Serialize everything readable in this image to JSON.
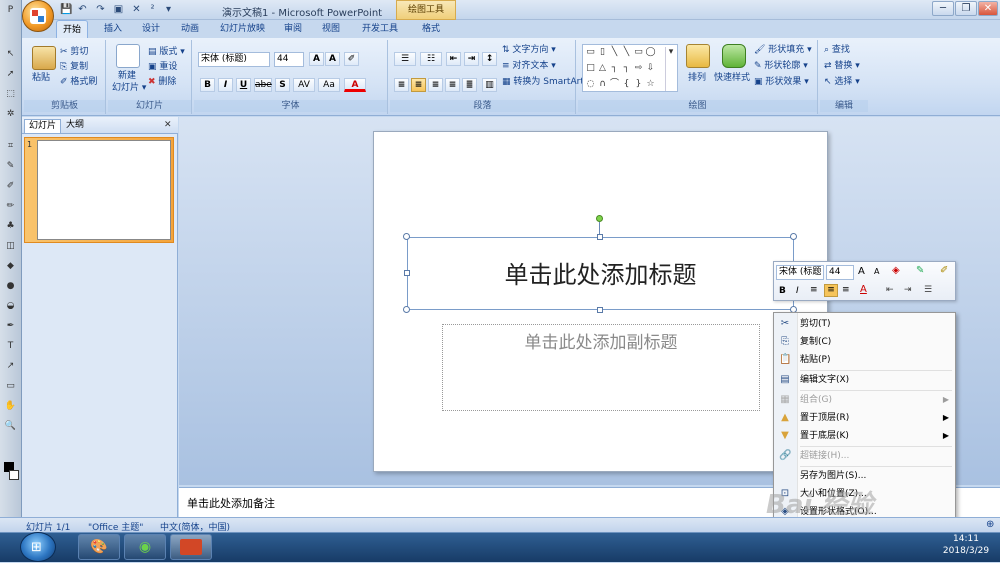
{
  "window": {
    "title": "演示文稿1 - Microsoft PowerPoint",
    "context_tab": "绘图工具",
    "controls": {
      "minimize": "─",
      "restore": "❐",
      "close": "✕"
    }
  },
  "quick_access": [
    "💾",
    "↶",
    "↷",
    "▣",
    "✕",
    "²",
    "▾"
  ],
  "tabs": [
    "开始",
    "插入",
    "设计",
    "动画",
    "幻灯片放映",
    "审阅",
    "视图",
    "开发工具",
    "格式"
  ],
  "active_tab": "开始",
  "ribbon": {
    "clipboard": {
      "label": "剪贴板",
      "paste": "粘贴",
      "cut": "剪切",
      "copy": "复制",
      "format_painter": "格式刷"
    },
    "slides": {
      "label": "幻灯片",
      "new_slide": "新建",
      "new_slide2": "幻灯片 ▾",
      "layout": "版式 ▾",
      "reset": "重设",
      "delete": "删除"
    },
    "font": {
      "label": "字体",
      "font_name": "宋体 (标题)",
      "font_size": "44",
      "bold": "B",
      "italic": "I",
      "underline": "U",
      "strike": "abe",
      "shadow": "S",
      "spacing": "AV",
      "case": "Aa",
      "color": "A"
    },
    "paragraph": {
      "label": "段落",
      "text_direction": "文字方向 ▾",
      "align_text": "对齐文本 ▾",
      "smartart": "转换为 SmartArt ▾"
    },
    "drawing": {
      "label": "绘图",
      "arrange": "排列",
      "quick_styles": "快速样式",
      "shape_fill": "形状填充 ▾",
      "shape_outline": "形状轮廓 ▾",
      "shape_effects": "形状效果 ▾"
    },
    "editing": {
      "label": "编辑",
      "find": "查找",
      "replace": "替换 ▾",
      "select": "选择 ▾"
    }
  },
  "panel": {
    "tab_slides": "幻灯片",
    "tab_outline": "大纲",
    "slide_number": "1"
  },
  "slide": {
    "title_placeholder": "单击此处添加标题",
    "subtitle_placeholder": "单击此处添加副标题"
  },
  "notes_placeholder": "单击此处添加备注",
  "mini_toolbar": {
    "font": "宋体 (标题",
    "size": "44",
    "bold": "B",
    "italic": "I",
    "color": "A"
  },
  "context_menu": [
    {
      "label": "剪切(T)",
      "icon": "✂",
      "disabled": false
    },
    {
      "label": "复制(C)",
      "icon": "⎘",
      "disabled": false
    },
    {
      "label": "粘贴(P)",
      "icon": "📋",
      "disabled": false
    },
    {
      "label": "编辑文字(X)",
      "icon": "▤",
      "disabled": false
    },
    {
      "label": "组合(G)",
      "icon": "▦",
      "disabled": true,
      "submenu": true
    },
    {
      "label": "置于顶层(R)",
      "icon": "▲",
      "disabled": false,
      "submenu": true
    },
    {
      "label": "置于底层(K)",
      "icon": "▼",
      "disabled": false,
      "submenu": true
    },
    {
      "label": "超链接(H)...",
      "icon": "🔗",
      "disabled": true
    },
    {
      "label": "另存为图片(S)...",
      "icon": "",
      "disabled": false
    },
    {
      "label": "大小和位置(Z)...",
      "icon": "⊡",
      "disabled": false
    },
    {
      "label": "设置形状格式(O)...",
      "icon": "◈",
      "disabled": false
    }
  ],
  "statusbar": {
    "slide": "幻灯片 1/1",
    "theme": "\"Office 主题\"",
    "language": "中文(简体，中国)"
  },
  "taskbar": {
    "time": "14:11",
    "date": "2018/3/29"
  },
  "watermark": "Bai 经验"
}
